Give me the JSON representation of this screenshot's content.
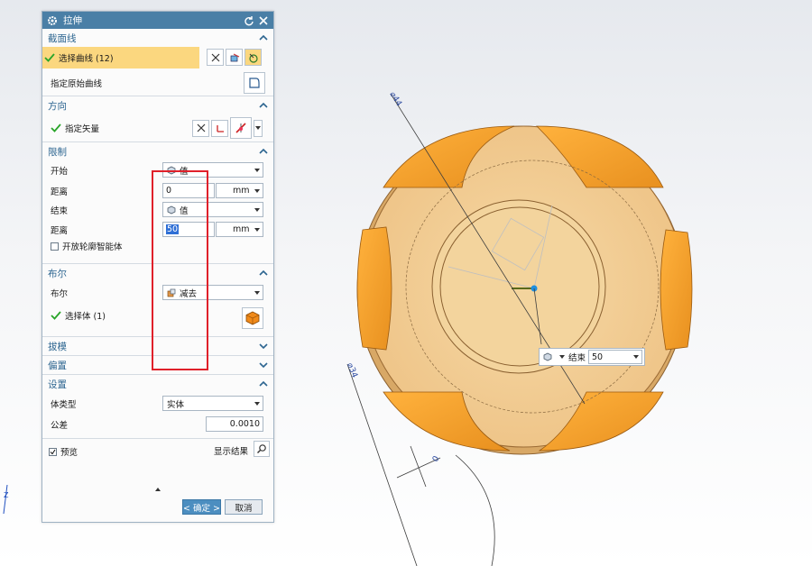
{
  "dialog": {
    "title": "拉伸",
    "sections": {
      "section_curve": {
        "title": "截面线",
        "select_curve_label": "选择曲线 (12)",
        "specify_origin_label": "指定原始曲线"
      },
      "direction": {
        "title": "方向",
        "specify_vector_label": "指定矢量"
      },
      "limits": {
        "title": "限制",
        "start_label": "开始",
        "start_type": "值",
        "start_distance_label": "距离",
        "start_distance": "0",
        "start_unit": "mm",
        "end_label": "结束",
        "end_type": "值",
        "end_distance_label": "距离",
        "end_distance": "50",
        "end_unit": "mm",
        "open_profile_label": "开放轮廓智能体"
      },
      "boolean": {
        "title": "布尔",
        "boolean_label": "布尔",
        "boolean_value": "减去",
        "select_body_label": "选择体 (1)"
      },
      "draft": {
        "title": "拔模"
      },
      "offset": {
        "title": "偏置"
      },
      "settings": {
        "title": "设置",
        "body_type_label": "体类型",
        "body_type_value": "实体",
        "tolerance_label": "公差",
        "tolerance_value": "0.0010"
      }
    },
    "preview_label": "预览",
    "show_result_label": "显示结果",
    "ok_label": "< 确定 >",
    "cancel_label": "取消"
  },
  "viewport": {
    "float_end_label": "结束",
    "float_end_value": "50",
    "dim_top": "⌀44",
    "dim_bottom": "⌀34",
    "dim_small": "0"
  },
  "colors": {
    "title_bar": "#4a7fa6",
    "section_title": "#2c6590",
    "highlight": "#fbd77f",
    "part_orange": "#f4a52d",
    "part_face": "#f1c98a",
    "annotation_box": "#e0202a",
    "ok_button": "#4c8ec0"
  }
}
